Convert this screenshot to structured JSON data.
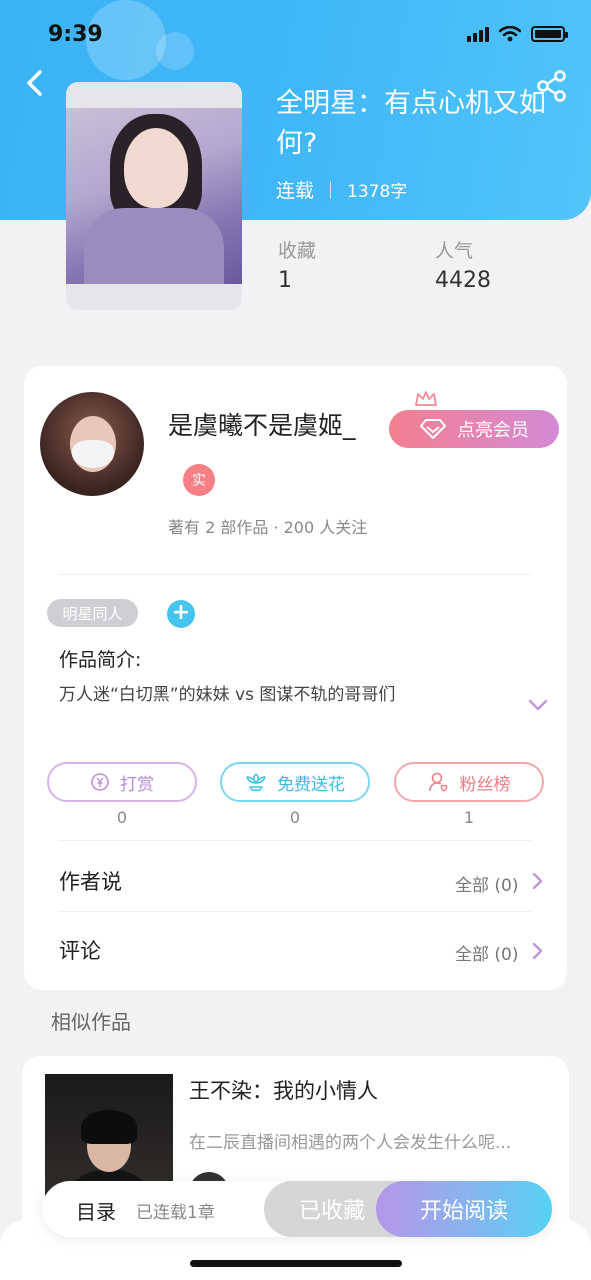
{
  "status_bar": {
    "time": "9:39"
  },
  "book": {
    "title": "全明星：有点心机又如何?",
    "status": "连载",
    "word_count": "1378字",
    "stats": [
      {
        "label": "收藏",
        "value": "1"
      },
      {
        "label": "人气",
        "value": "4428"
      }
    ]
  },
  "author": {
    "name": "是虞曦不是虞姬_",
    "real_badge": "实",
    "meta": "著有 2 部作品 · 200 人关注",
    "vip_button": "点亮会员"
  },
  "tags": [
    "明星同人"
  ],
  "tag_add": "+",
  "intro": {
    "label": "作品简介:",
    "text": "万人迷“白切黑”的妹妹 vs 图谋不轨的哥哥们"
  },
  "actions": [
    {
      "label": "打赏",
      "count": "0",
      "icon": "yen-coin-icon",
      "color": "#c48ee0"
    },
    {
      "label": "免费送花",
      "count": "0",
      "icon": "flower-icon",
      "color": "#3dc3ea"
    },
    {
      "label": "粉丝榜",
      "count": "1",
      "icon": "fan-user-icon",
      "color": "#ef7f85"
    }
  ],
  "rows": [
    {
      "label": "作者说",
      "right": "全部 (0)"
    },
    {
      "label": "评论",
      "right": "全部 (0)"
    }
  ],
  "similar": {
    "title": "相似作品",
    "items": [
      {
        "title": "王不染：我的小情人",
        "desc": "在二辰直播间相遇的两个人会发生什么呢..."
      }
    ]
  },
  "bottom_bar": {
    "toc": "目录",
    "toc_sub": "已连载1章",
    "collected": "已收藏",
    "read": "开始阅读"
  },
  "colors": {
    "header": "#3ab3f6",
    "vip_gradient": [
      "#f47f8f",
      "#d38ad6"
    ],
    "read_gradient": [
      "#b596e8",
      "#55d2f4"
    ]
  }
}
